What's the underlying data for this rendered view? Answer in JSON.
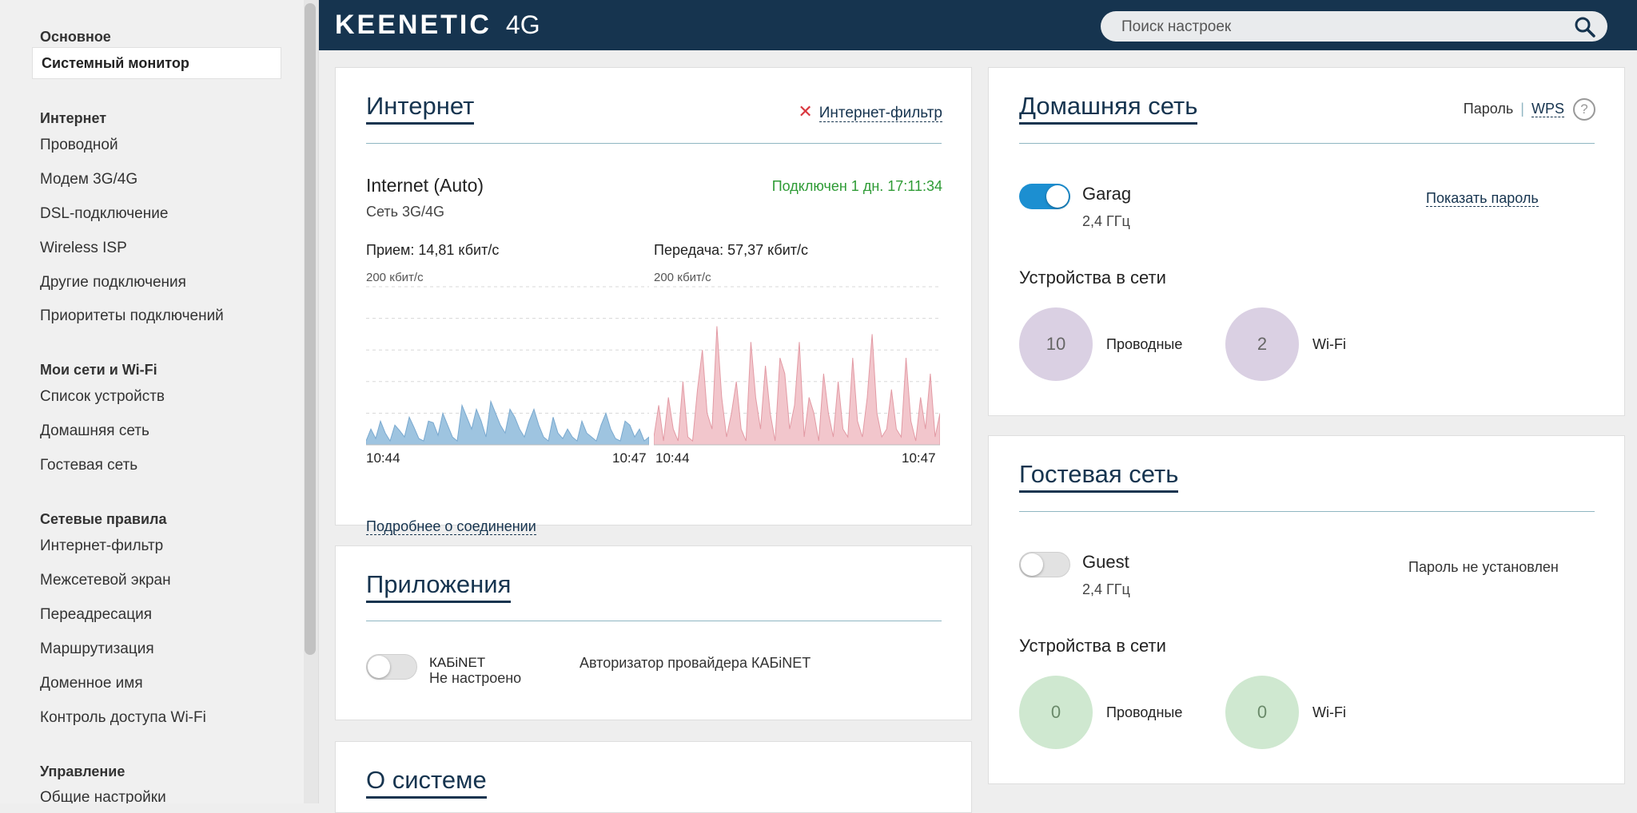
{
  "sidebar": {
    "group_main": "Основное",
    "active_item": "Системный монитор",
    "group_internet": "Интернет",
    "internet_items": [
      "Проводной",
      "Модем 3G/4G",
      "DSL-подключение",
      "Wireless ISP",
      "Другие подключения",
      "Приоритеты подключений"
    ],
    "group_networks": "Мои сети и Wi-Fi",
    "network_items": [
      "Список устройств",
      "Домашняя сеть",
      "Гостевая сеть"
    ],
    "group_rules": "Сетевые правила",
    "rules_items": [
      "Интернет-фильтр",
      "Межсетевой экран",
      "Переадресация",
      "Маршрутизация",
      "Доменное имя",
      "Контроль доступа Wi-Fi"
    ],
    "group_manage": "Управление",
    "manage_items": [
      "Общие настройки"
    ]
  },
  "header": {
    "logo": "KEENETIC",
    "logo_model": "4G",
    "search_placeholder": "Поиск настроек"
  },
  "internet": {
    "title": "Интернет",
    "filter_link": "Интернет-фильтр",
    "connection_name": "Internet (Auto)",
    "connection_type": "Сеть 3G/4G",
    "status": "Подключен 1 дн. 17:11:34",
    "rx_label": "Прием: 14,81 кбит/с",
    "tx_label": "Передача: 57,37 кбит/с",
    "scale_rx": "200 кбит/с",
    "scale_tx": "200 кбит/с",
    "time_start_rx": "10:44",
    "time_end_rx": "10:47",
    "time_start_tx": "10:44",
    "time_end_tx": "10:47",
    "details_link": "Подробнее о соединении"
  },
  "chart_data": [
    {
      "type": "area",
      "title": "",
      "ylabel": "200 кбит/с",
      "x_ticks": [
        "10:44",
        "10:47"
      ],
      "ylim": [
        0,
        200
      ],
      "grid": true,
      "color": "#9ec4e0",
      "values": [
        5,
        20,
        8,
        30,
        15,
        5,
        25,
        18,
        10,
        35,
        22,
        8,
        5,
        30,
        28,
        12,
        40,
        25,
        10,
        5,
        50,
        35,
        20,
        45,
        30,
        10,
        55,
        40,
        25,
        15,
        45,
        35,
        20,
        10,
        30,
        45,
        25,
        10,
        5,
        35,
        15,
        8,
        20,
        10,
        5,
        30,
        15,
        10,
        5,
        25,
        40,
        20,
        8,
        5,
        30,
        25,
        10,
        20,
        5,
        10
      ]
    },
    {
      "type": "area",
      "title": "",
      "ylabel": "200 кбит/с",
      "x_ticks": [
        "10:44",
        "10:47"
      ],
      "ylim": [
        0,
        200
      ],
      "grid": true,
      "color": "#f2c6cc",
      "values": [
        10,
        50,
        5,
        60,
        20,
        5,
        80,
        10,
        5,
        70,
        120,
        40,
        20,
        150,
        60,
        10,
        40,
        80,
        20,
        5,
        130,
        60,
        20,
        100,
        40,
        5,
        110,
        90,
        20,
        50,
        130,
        10,
        60,
        40,
        5,
        90,
        40,
        10,
        80,
        20,
        10,
        110,
        30,
        10,
        60,
        140,
        40,
        10,
        20,
        70,
        20,
        10,
        110,
        30,
        5,
        60,
        20,
        90,
        10,
        40
      ]
    }
  ],
  "apps": {
    "title": "Приложения",
    "app_name": "КАБiNET",
    "app_status": "Не настроено",
    "app_description": "Авторизатор провайдера КАБiNET"
  },
  "system": {
    "title": "О системе"
  },
  "home": {
    "title": "Домашняя сеть",
    "password_label": "Пароль",
    "separator": "|",
    "wps_label": "WPS",
    "help_icon": "?",
    "ssid": "Garag",
    "band": "2,4 ГГц",
    "show_password": "Показать пароль",
    "devices_title": "Устройства в сети",
    "wired_count": "10",
    "wired_label": "Проводные",
    "wifi_count": "2",
    "wifi_label": "Wi-Fi"
  },
  "guest": {
    "title": "Гостевая сеть",
    "ssid": "Guest",
    "band": "2,4 ГГц",
    "password_status": "Пароль не установлен",
    "devices_title": "Устройства в сети",
    "wired_count": "0",
    "wired_label": "Проводные",
    "wifi_count": "0",
    "wifi_label": "Wi-Fi"
  },
  "colors": {
    "header_bg": "#16344f",
    "accent": "#1c8fd1",
    "status_green": "#2e9b35",
    "filter_red": "#d9363e"
  }
}
